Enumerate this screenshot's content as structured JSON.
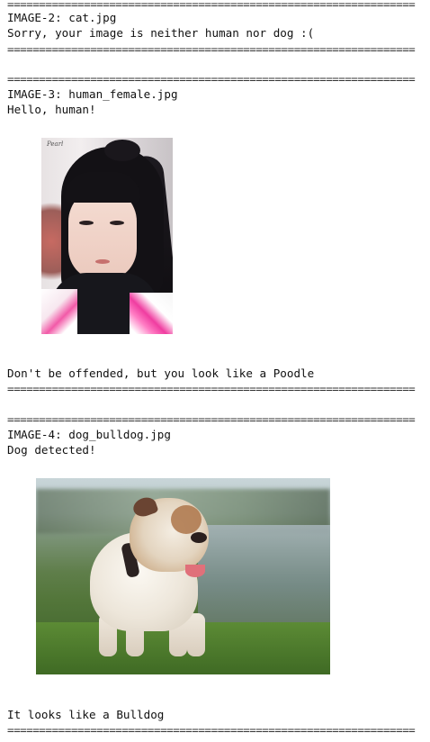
{
  "separator": "================================================================",
  "entries": [
    {
      "header": "IMAGE-2: cat.jpg",
      "message": "Sorry, your image is neither human nor dog :("
    },
    {
      "header": "IMAGE-3: human_female.jpg",
      "message": "Hello, human!",
      "result": "Don't be offended, but you look like a Poodle"
    },
    {
      "header": "IMAGE-4: dog_bulldog.jpg",
      "message": "Dog detected!",
      "result": "It looks like a Bulldog"
    }
  ],
  "human_photo_signature": "Pearl"
}
